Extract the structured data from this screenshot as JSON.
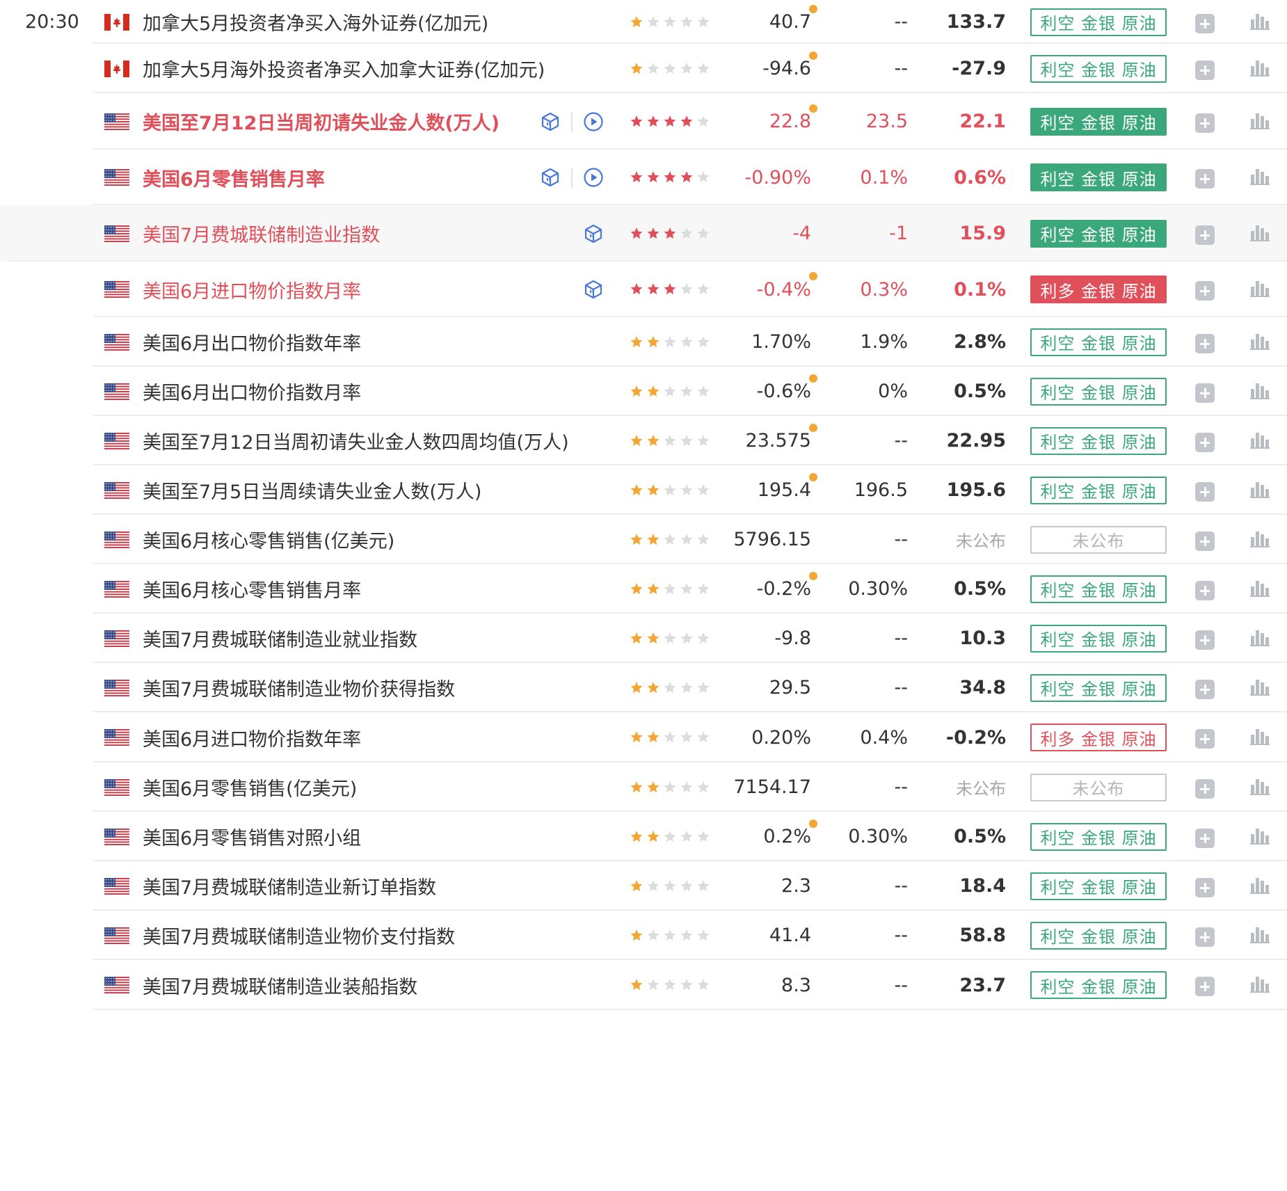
{
  "time": "20:30",
  "colors": {
    "bearish": "#3aa87a",
    "bullish": "#e0505b",
    "important_text": "#e0505b",
    "star_gold": "#f3a633",
    "star_red": "#e0505b",
    "star_empty": "#dcdcdc",
    "revised_dot": "#f3a633",
    "action_grey": "#c3c6cc"
  },
  "icons": {
    "add": "plus-square-icon",
    "chart": "bar-chart-icon",
    "cube": "cube-icon",
    "video": "play-circle-icon",
    "flag_ca": "canada-flag-icon",
    "flag_us": "usa-flag-icon"
  },
  "rows": [
    {
      "country": "ca",
      "name": "加拿大5月投资者净买入海外证券(亿加元)",
      "stars": 1,
      "previous": "40.7",
      "revised": true,
      "forecast": "--",
      "actual": "133.7",
      "tag": "利空 金银 原油",
      "tag_type": "bear",
      "show_time": true
    },
    {
      "country": "ca",
      "name": "加拿大5月海外投资者净买入加拿大证券(亿加元)",
      "stars": 1,
      "previous": "-94.6",
      "revised": true,
      "forecast": "--",
      "actual": "-27.9",
      "tag": "利空 金银 原油",
      "tag_type": "bear"
    },
    {
      "country": "us",
      "name": "美国至7月12日当周初请失业金人数(万人)",
      "stars": 4,
      "previous": "22.8",
      "revised": true,
      "forecast": "23.5",
      "actual": "22.1",
      "tag": "利空 金银 原油",
      "tag_type": "bear",
      "importance": "vimp",
      "cube": true,
      "video": true
    },
    {
      "country": "us",
      "name": "美国6月零售销售月率",
      "stars": 4,
      "previous": "-0.90%",
      "revised": false,
      "forecast": "0.1%",
      "actual": "0.6%",
      "tag": "利空 金银 原油",
      "tag_type": "bear",
      "importance": "vimp",
      "cube": true,
      "video": true
    },
    {
      "country": "us",
      "name": "美国7月费城联储制造业指数",
      "stars": 3,
      "previous": "-4",
      "revised": false,
      "forecast": "-1",
      "actual": "15.9",
      "tag": "利空 金银 原油",
      "tag_type": "bear",
      "importance": "imp",
      "cube": true,
      "highlight": true
    },
    {
      "country": "us",
      "name": "美国6月进口物价指数月率",
      "stars": 3,
      "previous": "-0.4%",
      "revised": true,
      "forecast": "0.3%",
      "actual": "0.1%",
      "tag": "利多 金银 原油",
      "tag_type": "bull",
      "importance": "imp",
      "cube": true
    },
    {
      "country": "us",
      "name": "美国6月出口物价指数年率",
      "stars": 2,
      "previous": "1.70%",
      "revised": false,
      "forecast": "1.9%",
      "actual": "2.8%",
      "tag": "利空 金银 原油",
      "tag_type": "bear"
    },
    {
      "country": "us",
      "name": "美国6月出口物价指数月率",
      "stars": 2,
      "previous": "-0.6%",
      "revised": true,
      "forecast": "0%",
      "actual": "0.5%",
      "tag": "利空 金银 原油",
      "tag_type": "bear"
    },
    {
      "country": "us",
      "name": "美国至7月12日当周初请失业金人数四周均值(万人)",
      "stars": 2,
      "previous": "23.575",
      "revised": true,
      "forecast": "--",
      "actual": "22.95",
      "tag": "利空 金银 原油",
      "tag_type": "bear"
    },
    {
      "country": "us",
      "name": "美国至7月5日当周续请失业金人数(万人)",
      "stars": 2,
      "previous": "195.4",
      "revised": true,
      "forecast": "196.5",
      "actual": "195.6",
      "tag": "利空 金银 原油",
      "tag_type": "bear"
    },
    {
      "country": "us",
      "name": "美国6月核心零售销售(亿美元)",
      "stars": 2,
      "previous": "5796.15",
      "revised": false,
      "forecast": "--",
      "actual": "未公布",
      "tag": "未公布",
      "tag_type": "np"
    },
    {
      "country": "us",
      "name": "美国6月核心零售销售月率",
      "stars": 2,
      "previous": "-0.2%",
      "revised": true,
      "forecast": "0.30%",
      "actual": "0.5%",
      "tag": "利空 金银 原油",
      "tag_type": "bear"
    },
    {
      "country": "us",
      "name": "美国7月费城联储制造业就业指数",
      "stars": 2,
      "previous": "-9.8",
      "revised": false,
      "forecast": "--",
      "actual": "10.3",
      "tag": "利空 金银 原油",
      "tag_type": "bear"
    },
    {
      "country": "us",
      "name": "美国7月费城联储制造业物价获得指数",
      "stars": 2,
      "previous": "29.5",
      "revised": false,
      "forecast": "--",
      "actual": "34.8",
      "tag": "利空 金银 原油",
      "tag_type": "bear"
    },
    {
      "country": "us",
      "name": "美国6月进口物价指数年率",
      "stars": 2,
      "previous": "0.20%",
      "revised": false,
      "forecast": "0.4%",
      "actual": "-0.2%",
      "tag": "利多 金银 原油",
      "tag_type": "bull"
    },
    {
      "country": "us",
      "name": "美国6月零售销售(亿美元)",
      "stars": 2,
      "previous": "7154.17",
      "revised": false,
      "forecast": "--",
      "actual": "未公布",
      "tag": "未公布",
      "tag_type": "np"
    },
    {
      "country": "us",
      "name": "美国6月零售销售对照小组",
      "stars": 2,
      "previous": "0.2%",
      "revised": true,
      "forecast": "0.30%",
      "actual": "0.5%",
      "tag": "利空 金银 原油",
      "tag_type": "bear"
    },
    {
      "country": "us",
      "name": "美国7月费城联储制造业新订单指数",
      "stars": 1,
      "previous": "2.3",
      "revised": false,
      "forecast": "--",
      "actual": "18.4",
      "tag": "利空 金银 原油",
      "tag_type": "bear"
    },
    {
      "country": "us",
      "name": "美国7月费城联储制造业物价支付指数",
      "stars": 1,
      "previous": "41.4",
      "revised": false,
      "forecast": "--",
      "actual": "58.8",
      "tag": "利空 金银 原油",
      "tag_type": "bear"
    },
    {
      "country": "us",
      "name": "美国7月费城联储制造业装船指数",
      "stars": 1,
      "previous": "8.3",
      "revised": false,
      "forecast": "--",
      "actual": "23.7",
      "tag": "利空 金银 原油",
      "tag_type": "bear"
    }
  ]
}
